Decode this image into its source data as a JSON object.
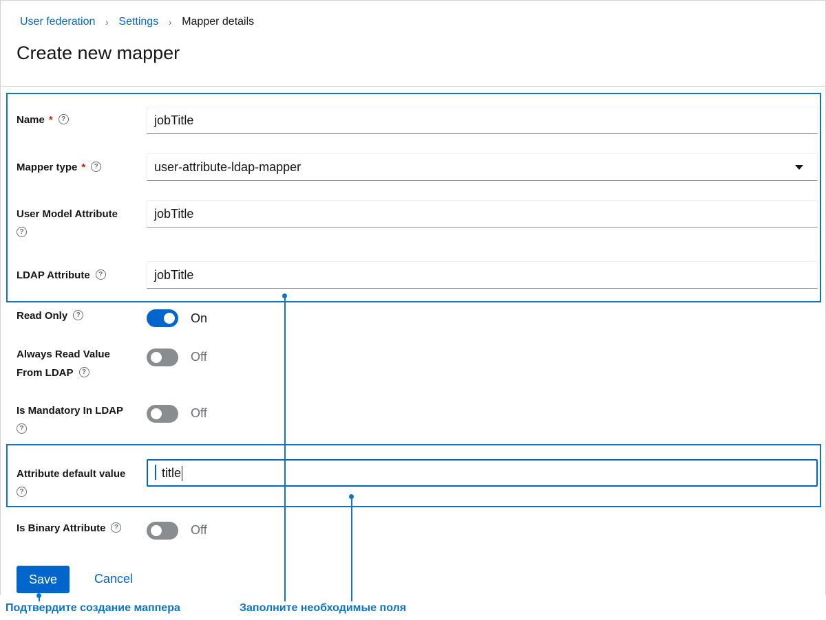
{
  "breadcrumb": {
    "items": [
      "User federation",
      "Settings",
      "Mapper details"
    ],
    "separator": "›"
  },
  "page_title": "Create new mapper",
  "form": {
    "name": {
      "label": "Name",
      "required_mark": "*",
      "value": "jobTitle"
    },
    "mapper_type": {
      "label": "Mapper type",
      "required_mark": "*",
      "value": "user-attribute-ldap-mapper"
    },
    "user_model_attribute": {
      "label": "User Model Attribute",
      "value": "jobTitle"
    },
    "ldap_attribute": {
      "label": "LDAP Attribute",
      "value": "jobTitle"
    },
    "read_only": {
      "label": "Read Only",
      "state": true,
      "state_text": "On"
    },
    "always_read_value": {
      "label_line1": "Always Read Value",
      "label_line2": "From LDAP",
      "state": false,
      "state_text": "Off"
    },
    "is_mandatory": {
      "label": "Is Mandatory In LDAP",
      "state": false,
      "state_text": "Off"
    },
    "attribute_default_value": {
      "label": "Attribute default value",
      "value": "title"
    },
    "is_binary": {
      "label": "Is Binary Attribute",
      "state": false,
      "state_text": "Off"
    },
    "help_icon_glyph": "?"
  },
  "actions": {
    "save": "Save",
    "cancel": "Cancel"
  },
  "annotations": {
    "confirm": "Подтвердите создание маппера",
    "fill_fields": "Заполните необходимые поля",
    "color": "#0d73c6"
  },
  "colors": {
    "primary": "#0066cc",
    "required": "#c9190b",
    "toggle_off": "#8a8d90"
  }
}
